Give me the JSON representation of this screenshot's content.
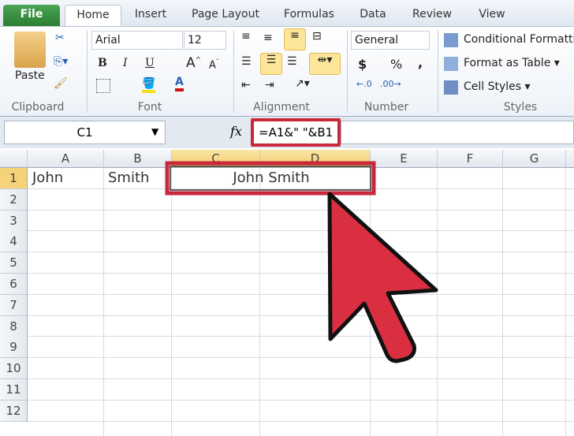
{
  "tabs": [
    "File",
    "Home",
    "Insert",
    "Page Layout",
    "Formulas",
    "Data",
    "Review",
    "View"
  ],
  "ribbon": {
    "clipboard": {
      "label": "Clipboard",
      "paste": "Paste"
    },
    "font": {
      "label": "Font",
      "name": "Arial",
      "size": "12",
      "bold": "B",
      "italic": "I",
      "underline": "U"
    },
    "alignment": {
      "label": "Alignment"
    },
    "number": {
      "label": "Number",
      "format": "General",
      "currency": "$",
      "percent": "%",
      "comma": ","
    },
    "styles": {
      "label": "Styles",
      "conditional": "Conditional Formatting",
      "format_table": "Format as Table",
      "cell_styles": "Cell Styles"
    }
  },
  "formula_bar": {
    "name_box": "C1",
    "fx": "fx",
    "formula": "=A1&\" \"&B1"
  },
  "columns": [
    "A",
    "B",
    "C",
    "D",
    "E",
    "F",
    "G"
  ],
  "rows": [
    "1",
    "2",
    "3",
    "4",
    "5",
    "6",
    "7",
    "8",
    "9",
    "10",
    "11",
    "12"
  ],
  "cells": {
    "A1": "John",
    "B1": "Smith",
    "C1": "John Smith"
  },
  "colors": {
    "highlight": "#c9273a",
    "file_tab": "#2f8a37",
    "selection": "#f6d27a"
  }
}
